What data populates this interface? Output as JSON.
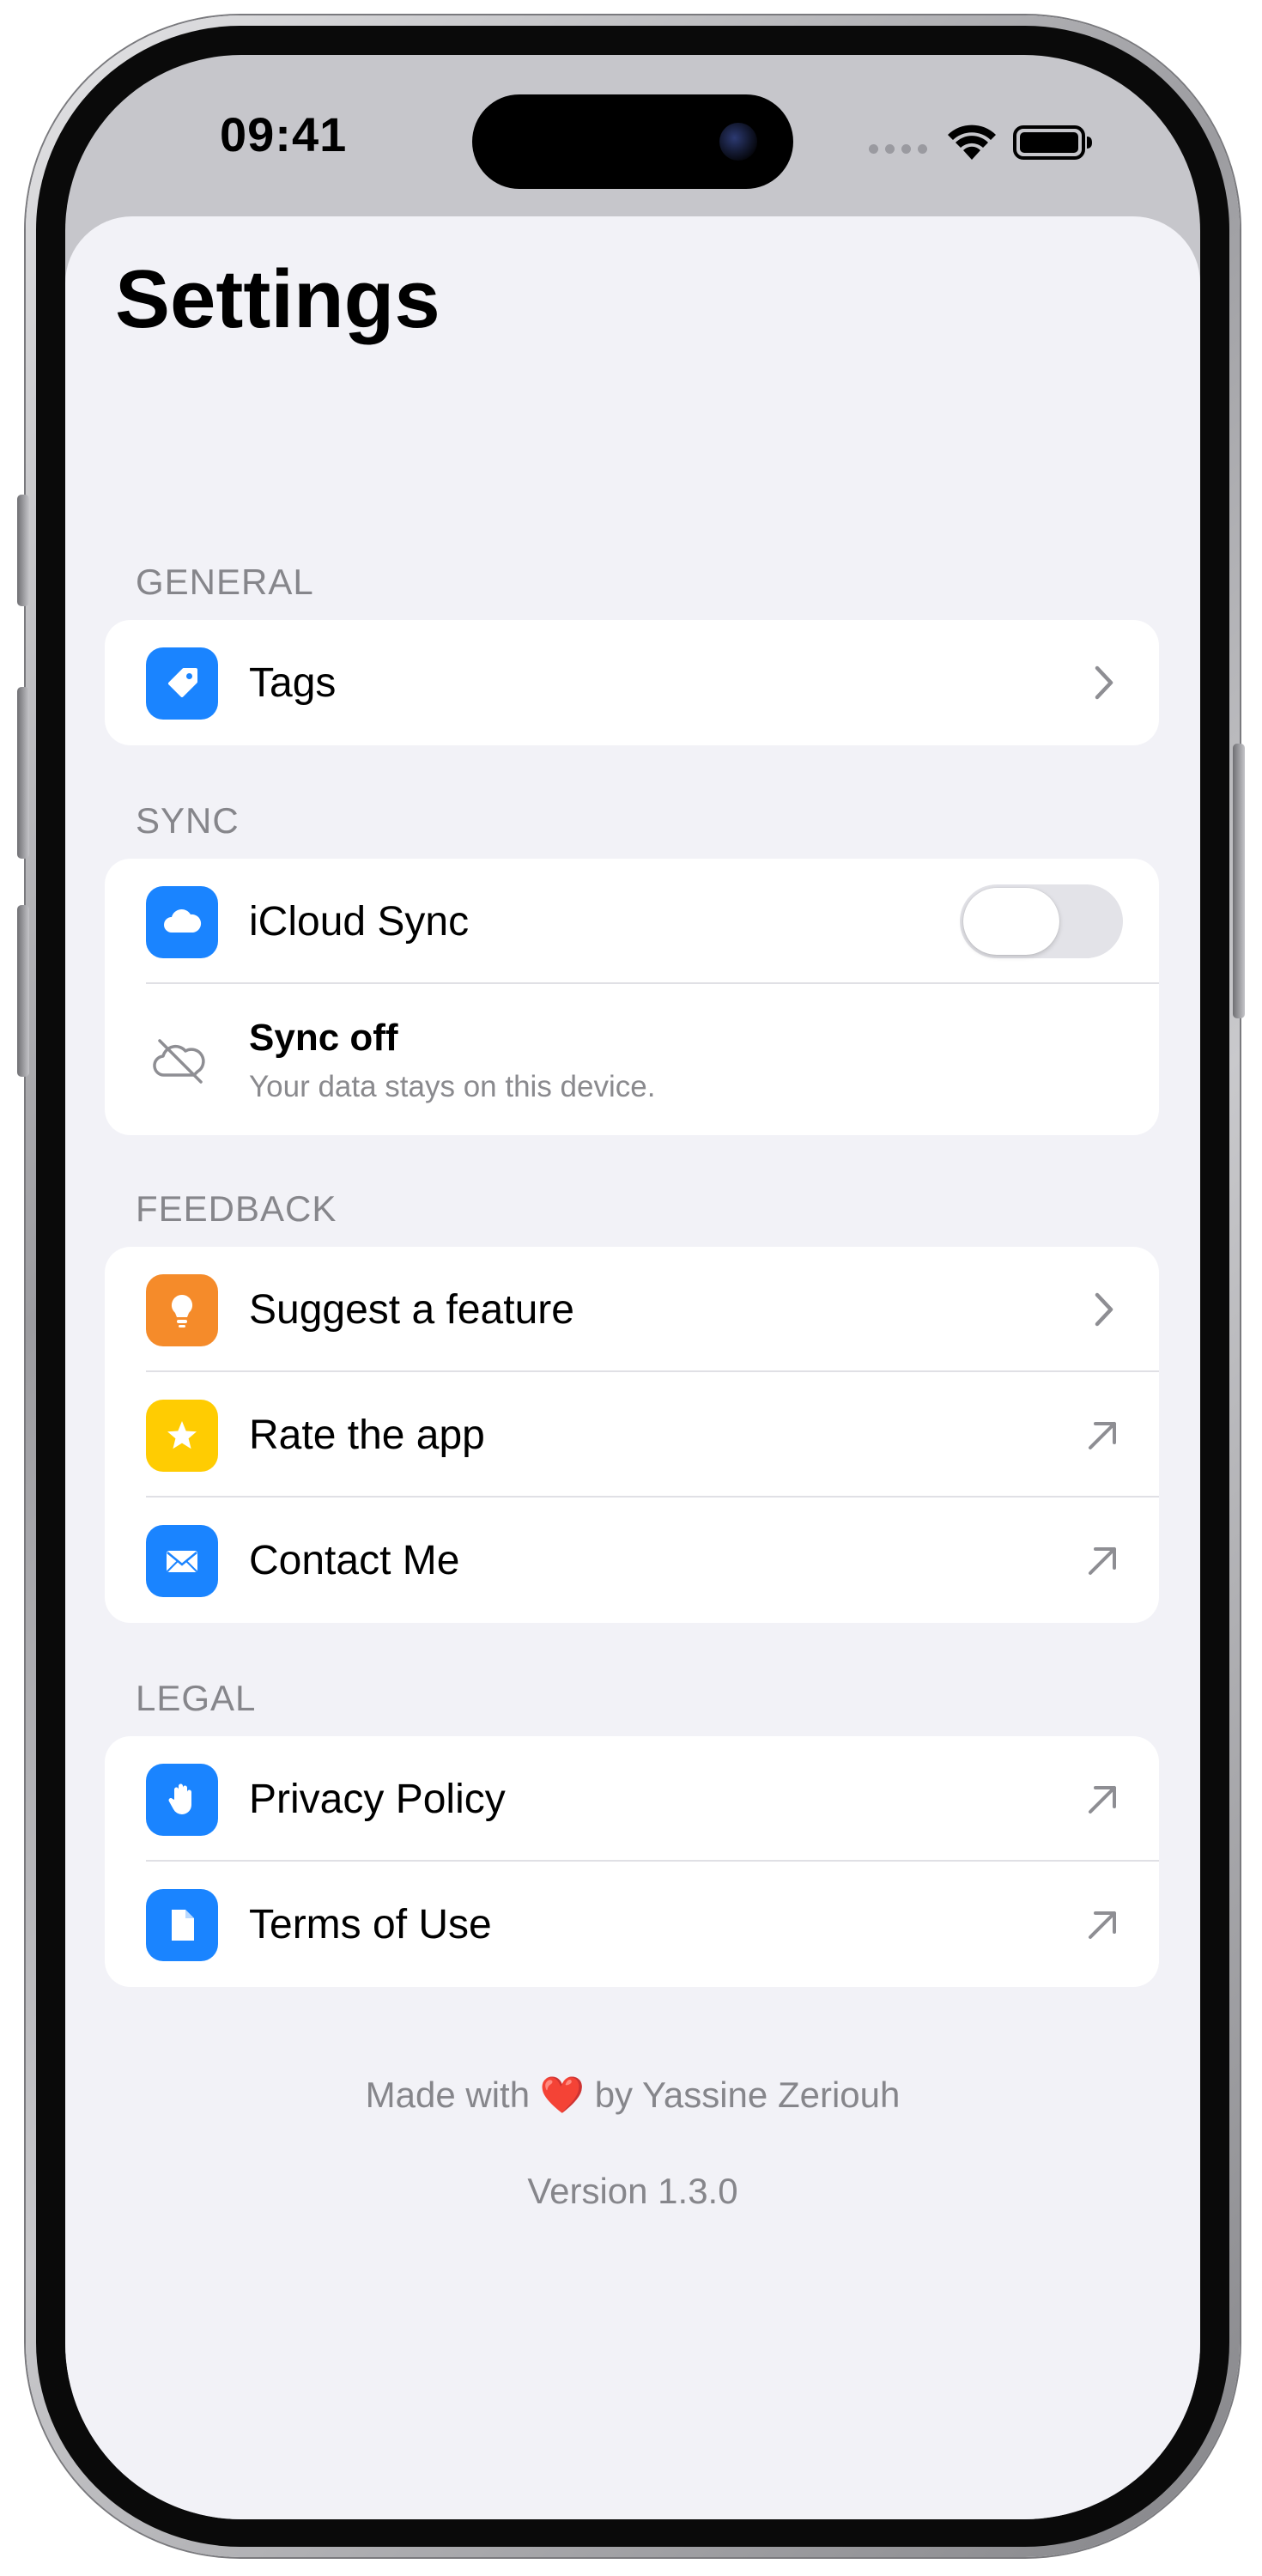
{
  "status_bar": {
    "time": "09:41"
  },
  "page": {
    "title": "Settings"
  },
  "sections": {
    "general": {
      "header": "GENERAL",
      "items": [
        {
          "label": "Tags",
          "icon": "tag-icon",
          "icon_color": "#1a84ff",
          "trailing": "chevron-right-icon"
        }
      ]
    },
    "sync": {
      "header": "SYNC",
      "toggle": {
        "label": "iCloud Sync",
        "icon": "cloud-icon",
        "icon_color": "#1a84ff",
        "state": "off"
      },
      "status": {
        "title": "Sync off",
        "subtitle": "Your data stays on this device.",
        "icon": "cloud-off-icon"
      }
    },
    "feedback": {
      "header": "FEEDBACK",
      "items": [
        {
          "label": "Suggest a feature",
          "icon": "lightbulb-icon",
          "icon_color": "#f58b2a",
          "trailing": "chevron-right-icon"
        },
        {
          "label": "Rate the app",
          "icon": "star-icon",
          "icon_color": "#ffcc02",
          "trailing": "external-link-arrow-icon"
        },
        {
          "label": "Contact Me",
          "icon": "envelope-icon",
          "icon_color": "#1a84ff",
          "trailing": "external-link-arrow-icon"
        }
      ]
    },
    "legal": {
      "header": "LEGAL",
      "items": [
        {
          "label": "Privacy Policy",
          "icon": "hand-icon",
          "icon_color": "#1a84ff",
          "trailing": "external-link-arrow-icon"
        },
        {
          "label": "Terms of Use",
          "icon": "document-icon",
          "icon_color": "#1a84ff",
          "trailing": "external-link-arrow-icon"
        }
      ]
    }
  },
  "footer": {
    "made_with": "Made with",
    "heart": "❤️",
    "by": "by Yassine Zeriouh",
    "version": "Version 1.3.0"
  },
  "colors": {
    "background": "#f2f2f7",
    "card": "#ffffff",
    "accent_blue": "#1a84ff",
    "secondary_text": "#86868b"
  }
}
